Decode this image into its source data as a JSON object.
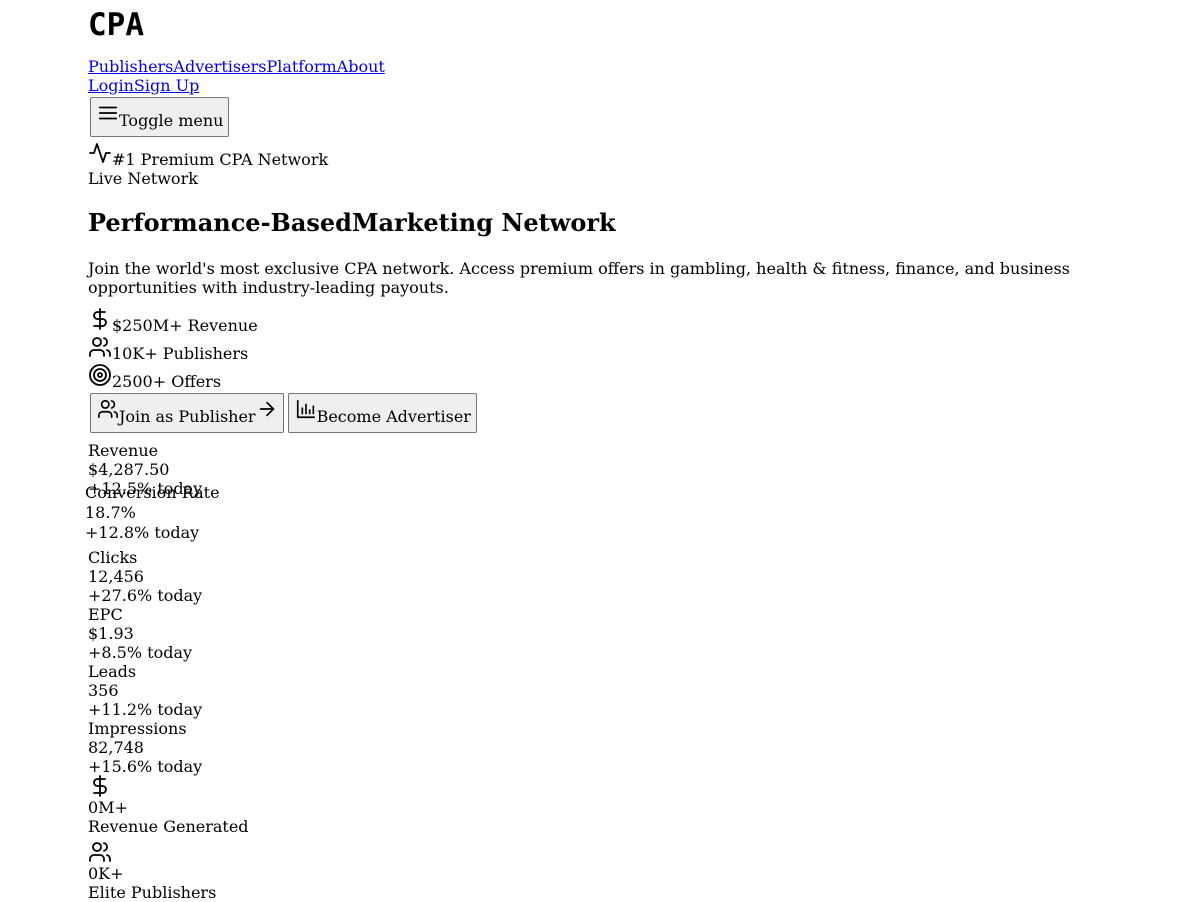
{
  "brand": {
    "logo_text": "CPA"
  },
  "nav": {
    "links": [
      "Publishers",
      "Advertisers",
      "Platform",
      "About"
    ],
    "login": "Login",
    "signup": "Sign Up",
    "toggle": "Toggle menu"
  },
  "hero": {
    "badge": "#1 Premium CPA Network",
    "live": "Live Network",
    "title_part1": "Performance-Based",
    "title_part2": "Marketing Network",
    "description": "Join the world's most exclusive CPA network. Access premium offers in gambling, health & fitness, finance, and business opportunities with industry-leading payouts.",
    "stats": [
      {
        "icon": "dollar-icon",
        "label": "$250M+ Revenue"
      },
      {
        "icon": "users-icon",
        "label": "10K+ Publishers"
      },
      {
        "icon": "target-icon",
        "label": "2500+ Offers"
      }
    ],
    "cta_publisher": "Join as Publisher",
    "cta_advertiser": "Become Advertiser"
  },
  "dashboard": {
    "metrics": [
      {
        "label": "Revenue",
        "value": "$4,287.50",
        "change": "+12.5% today"
      },
      {
        "label": "Conversion Rate",
        "value": "18.7%",
        "change": "+12.8% today"
      },
      {
        "label": "Clicks",
        "value": "12,456",
        "change": "+27.6% today"
      },
      {
        "label": "EPC",
        "value": "$1.93",
        "change": "+8.5% today"
      },
      {
        "label": "Leads",
        "value": "356",
        "change": "+11.2% today"
      },
      {
        "label": "Impressions",
        "value": "82,748",
        "change": "+15.6% today"
      }
    ]
  },
  "totals": [
    {
      "icon": "dollar-icon",
      "value": "0M+",
      "label": "Revenue Generated"
    },
    {
      "icon": "users-icon",
      "value": "0K+",
      "label": "Elite Publishers"
    }
  ]
}
